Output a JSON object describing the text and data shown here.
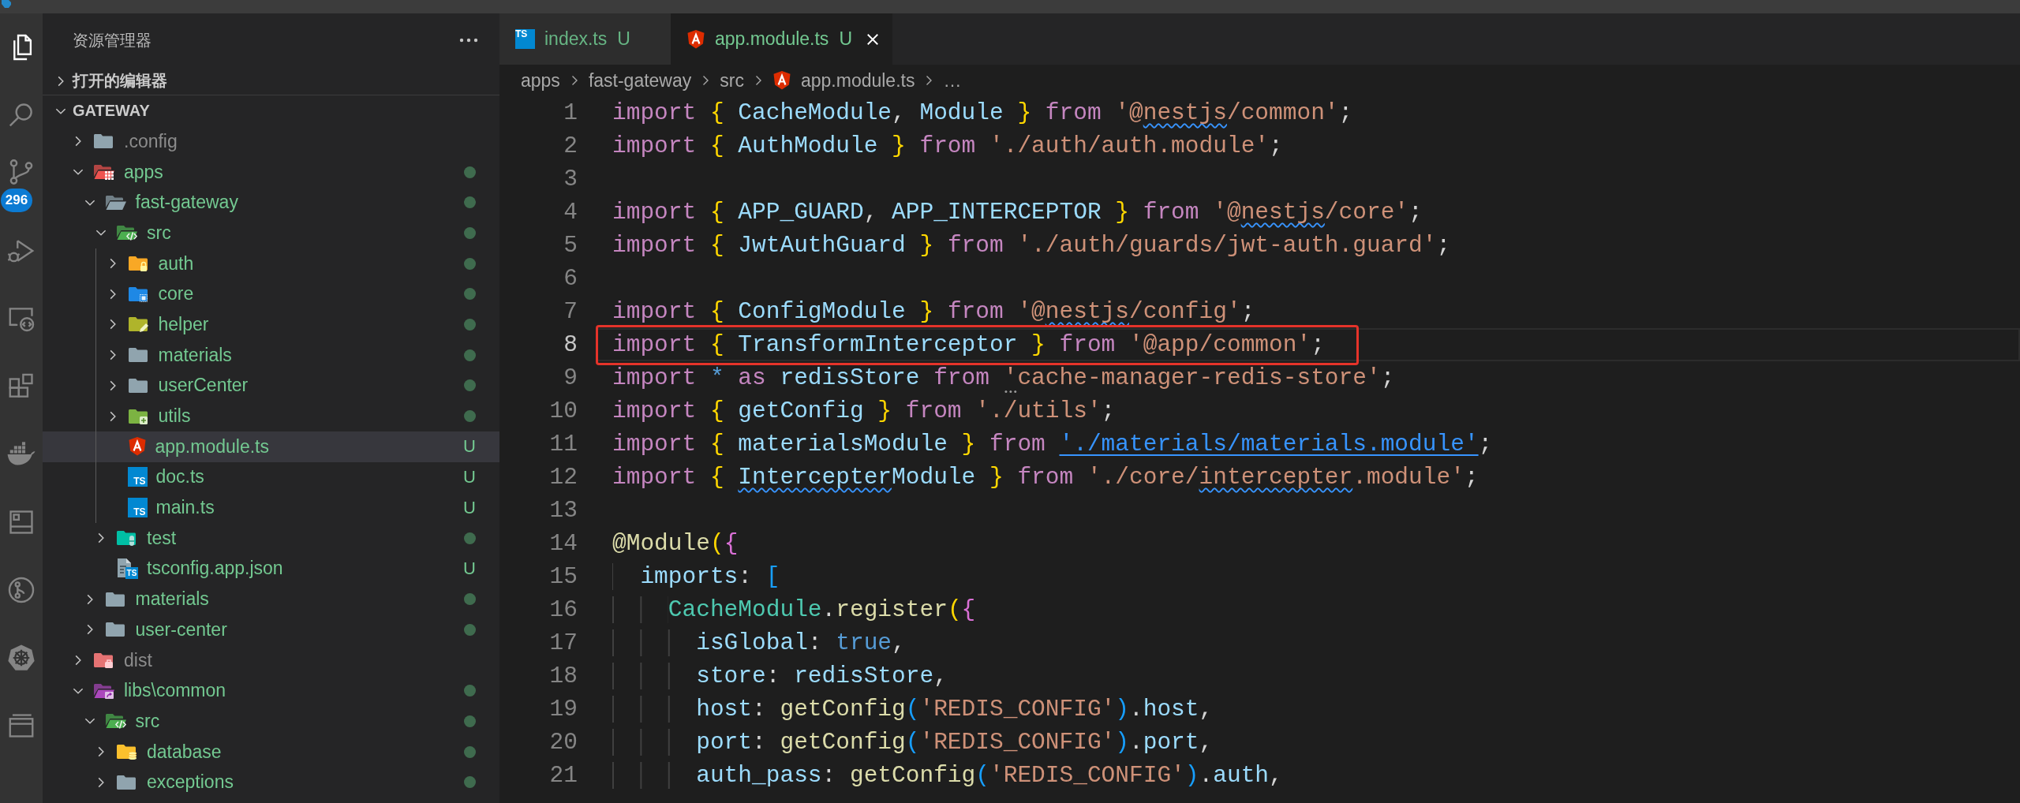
{
  "activity_bar": {
    "items": [
      {
        "kind": "explorer",
        "selected": true
      },
      {
        "kind": "search",
        "selected": false
      },
      {
        "kind": "scm",
        "selected": false,
        "badge": "296"
      },
      {
        "kind": "debug",
        "selected": false
      },
      {
        "kind": "remote",
        "selected": false
      },
      {
        "kind": "extensions",
        "selected": false
      },
      {
        "kind": "docker",
        "selected": false
      },
      {
        "kind": "panel",
        "selected": false
      },
      {
        "kind": "gitgraph",
        "selected": false
      },
      {
        "kind": "kubernetes",
        "selected": false
      },
      {
        "kind": "layers",
        "selected": false
      }
    ]
  },
  "explorer": {
    "title": "资源管理器",
    "sections": [
      {
        "title": "打开的编辑器",
        "expanded": false
      },
      {
        "title": "GATEWAY",
        "expanded": true,
        "tree": [
          {
            "label": ".config",
            "kind": "folder",
            "expanded": false,
            "selected": false,
            "ignored": true,
            "changed": false
          },
          {
            "label": "apps",
            "kind": "appsfolder",
            "expanded": true,
            "selected": false,
            "ignored": false,
            "changed": true,
            "children": [
              {
                "label": "fast-gateway",
                "kind": "folder",
                "expanded": true,
                "selected": false,
                "ignored": false,
                "changed": true,
                "children": [
                  {
                    "label": "src",
                    "kind": "srcfolder",
                    "expanded": true,
                    "selected": false,
                    "ignored": false,
                    "changed": true,
                    "children": [
                      {
                        "label": "auth",
                        "kind": "authfolder",
                        "expanded": false,
                        "selected": false,
                        "ignored": false,
                        "changed": true
                      },
                      {
                        "label": "core",
                        "kind": "corefolder",
                        "expanded": false,
                        "selected": false,
                        "ignored": false,
                        "changed": true
                      },
                      {
                        "label": "helper",
                        "kind": "helperfolder",
                        "expanded": false,
                        "selected": false,
                        "ignored": false,
                        "changed": true
                      },
                      {
                        "label": "materials",
                        "kind": "folder",
                        "expanded": false,
                        "selected": false,
                        "ignored": false,
                        "changed": true
                      },
                      {
                        "label": "userCenter",
                        "kind": "folder",
                        "expanded": false,
                        "selected": false,
                        "ignored": false,
                        "changed": true
                      },
                      {
                        "label": "utils",
                        "kind": "utilsfolder",
                        "expanded": false,
                        "selected": false,
                        "ignored": false,
                        "changed": true
                      },
                      {
                        "label": "app.module.ts",
                        "kind": "angular",
                        "selected": true,
                        "ignored": false,
                        "status": "U"
                      },
                      {
                        "label": "doc.ts",
                        "kind": "typescript",
                        "icon_text": "TS",
                        "selected": false,
                        "ignored": false,
                        "status": "U"
                      },
                      {
                        "label": "main.ts",
                        "kind": "typescript",
                        "icon_text": "TS",
                        "selected": false,
                        "ignored": false,
                        "status": "U"
                      }
                    ]
                  },
                  {
                    "label": "test",
                    "kind": "testfolder",
                    "expanded": false,
                    "selected": false,
                    "ignored": false,
                    "changed": true
                  },
                  {
                    "label": "tsconfig.app.json",
                    "kind": "tsconfig",
                    "icon_text": "TS",
                    "selected": false,
                    "ignored": false,
                    "status": "U"
                  }
                ]
              },
              {
                "label": "materials",
                "kind": "folder",
                "expanded": false,
                "selected": false,
                "ignored": false,
                "changed": true
              },
              {
                "label": "user-center",
                "kind": "folder",
                "expanded": false,
                "selected": false,
                "ignored": false,
                "changed": true
              }
            ]
          },
          {
            "label": "dist",
            "kind": "distfolder",
            "expanded": false,
            "selected": false,
            "ignored": true,
            "changed": false
          },
          {
            "label": "libs\\common",
            "kind": "libfolder",
            "expanded": true,
            "selected": false,
            "ignored": false,
            "changed": true,
            "children": [
              {
                "label": "src",
                "kind": "srcfolder",
                "expanded": true,
                "selected": false,
                "ignored": false,
                "changed": true,
                "children": [
                  {
                    "label": "database",
                    "kind": "databasefolder",
                    "expanded": false,
                    "selected": false,
                    "ignored": false,
                    "changed": true
                  },
                  {
                    "label": "exceptions",
                    "kind": "folder",
                    "expanded": false,
                    "selected": false,
                    "ignored": false,
                    "changed": true
                  }
                ]
              }
            ]
          }
        ]
      }
    ]
  },
  "editor": {
    "tabs": [
      {
        "label": "index.ts",
        "kind": "typescript",
        "icon_text": "TS",
        "status": "U",
        "selected": false
      },
      {
        "label": "app.module.ts",
        "kind": "angular",
        "status": "U",
        "selected": true
      }
    ],
    "breadcrumb": [
      {
        "label": "apps",
        "kind": "folder"
      },
      {
        "label": "fast-gateway",
        "kind": "folder"
      },
      {
        "label": "src",
        "kind": "folder"
      },
      {
        "label": "app.module.ts",
        "kind": "angular"
      },
      {
        "label": "…",
        "kind": "more"
      }
    ],
    "lines": [
      {
        "number": "1",
        "current": false,
        "annotated": false,
        "tokens": [
          {
            "text": "import ",
            "kind": "keyword"
          },
          {
            "text": "{ ",
            "kind": "bracket1"
          },
          {
            "text": "CacheModule",
            "kind": "variable"
          },
          {
            "text": ", ",
            "kind": "punctuation"
          },
          {
            "text": "Module ",
            "kind": "variable"
          },
          {
            "text": "} ",
            "kind": "bracket1"
          },
          {
            "text": "from ",
            "kind": "keyword"
          },
          {
            "text": "'@",
            "kind": "string"
          },
          {
            "text": "nestjs",
            "kind": "string",
            "squiggle": true
          },
          {
            "text": "/common'",
            "kind": "string"
          },
          {
            "text": ";",
            "kind": "punctuation"
          }
        ]
      },
      {
        "number": "2",
        "current": false,
        "annotated": false,
        "tokens": [
          {
            "text": "import ",
            "kind": "keyword"
          },
          {
            "text": "{ ",
            "kind": "bracket1"
          },
          {
            "text": "AuthModule ",
            "kind": "variable"
          },
          {
            "text": "} ",
            "kind": "bracket1"
          },
          {
            "text": "from ",
            "kind": "keyword"
          },
          {
            "text": "'./auth/auth.module'",
            "kind": "string"
          },
          {
            "text": ";",
            "kind": "punctuation"
          }
        ]
      },
      {
        "number": "3",
        "current": false,
        "annotated": false
      },
      {
        "number": "4",
        "current": false,
        "annotated": false,
        "tokens": [
          {
            "text": "import ",
            "kind": "keyword"
          },
          {
            "text": "{ ",
            "kind": "bracket1"
          },
          {
            "text": "APP_GUARD",
            "kind": "variable"
          },
          {
            "text": ", ",
            "kind": "punctuation"
          },
          {
            "text": "APP_INTERCEPTOR ",
            "kind": "variable"
          },
          {
            "text": "} ",
            "kind": "bracket1"
          },
          {
            "text": "from ",
            "kind": "keyword"
          },
          {
            "text": "'@",
            "kind": "string"
          },
          {
            "text": "nestjs",
            "kind": "string",
            "squiggle": true
          },
          {
            "text": "/core'",
            "kind": "string"
          },
          {
            "text": ";",
            "kind": "punctuation"
          }
        ]
      },
      {
        "number": "5",
        "current": false,
        "annotated": false,
        "tokens": [
          {
            "text": "import ",
            "kind": "keyword"
          },
          {
            "text": "{ ",
            "kind": "bracket1"
          },
          {
            "text": "JwtAuthGuard ",
            "kind": "variable"
          },
          {
            "text": "} ",
            "kind": "bracket1"
          },
          {
            "text": "from ",
            "kind": "keyword"
          },
          {
            "text": "'./auth/guards/jwt-auth.guard'",
            "kind": "string"
          },
          {
            "text": ";",
            "kind": "punctuation"
          }
        ]
      },
      {
        "number": "6",
        "current": false,
        "annotated": false
      },
      {
        "number": "7",
        "current": false,
        "annotated": false,
        "tokens": [
          {
            "text": "import ",
            "kind": "keyword"
          },
          {
            "text": "{ ",
            "kind": "bracket1"
          },
          {
            "text": "ConfigModule ",
            "kind": "variable"
          },
          {
            "text": "} ",
            "kind": "bracket1"
          },
          {
            "text": "from ",
            "kind": "keyword"
          },
          {
            "text": "'@",
            "kind": "string"
          },
          {
            "text": "nestjs",
            "kind": "string",
            "squiggle": true
          },
          {
            "text": "/config'",
            "kind": "string"
          },
          {
            "text": ";",
            "kind": "punctuation"
          }
        ]
      },
      {
        "number": "8",
        "current": true,
        "annotated": true,
        "tokens": [
          {
            "text": "import ",
            "kind": "keyword"
          },
          {
            "text": "{ ",
            "kind": "bracket1"
          },
          {
            "text": "TransformInterceptor ",
            "kind": "variable"
          },
          {
            "text": "} ",
            "kind": "bracket1"
          },
          {
            "text": "from ",
            "kind": "keyword"
          },
          {
            "text": "'@app/common'",
            "kind": "string"
          },
          {
            "text": ";",
            "kind": "punctuation"
          }
        ]
      },
      {
        "number": "9",
        "current": false,
        "annotated": false,
        "tokens": [
          {
            "text": "import ",
            "kind": "keyword"
          },
          {
            "text": "* ",
            "kind": "operator"
          },
          {
            "text": "as ",
            "kind": "keyword"
          },
          {
            "text": "redisStore ",
            "kind": "variable"
          },
          {
            "text": "from ",
            "kind": "keyword"
          },
          {
            "text": "'",
            "kind": "string",
            "hint": true
          },
          {
            "text": "cache-manager-redis-store'",
            "kind": "string"
          },
          {
            "text": ";",
            "kind": "punctuation"
          }
        ]
      },
      {
        "number": "10",
        "current": false,
        "annotated": false,
        "tokens": [
          {
            "text": "import ",
            "kind": "keyword"
          },
          {
            "text": "{ ",
            "kind": "bracket1"
          },
          {
            "text": "getConfig ",
            "kind": "variable"
          },
          {
            "text": "} ",
            "kind": "bracket1"
          },
          {
            "text": "from ",
            "kind": "keyword"
          },
          {
            "text": "'./utils'",
            "kind": "string"
          },
          {
            "text": ";",
            "kind": "punctuation"
          }
        ]
      },
      {
        "number": "11",
        "current": false,
        "annotated": false,
        "tokens": [
          {
            "text": "import ",
            "kind": "keyword"
          },
          {
            "text": "{ ",
            "kind": "bracket1"
          },
          {
            "text": "materialsModule ",
            "kind": "variable"
          },
          {
            "text": "} ",
            "kind": "bracket1"
          },
          {
            "text": "from ",
            "kind": "keyword"
          },
          {
            "text": "'./materials/materials.module'",
            "kind": "link"
          },
          {
            "text": ";",
            "kind": "punctuation"
          }
        ]
      },
      {
        "number": "12",
        "current": false,
        "annotated": false,
        "tokens": [
          {
            "text": "import ",
            "kind": "keyword"
          },
          {
            "text": "{ ",
            "kind": "bracket1"
          },
          {
            "text": "Intercepter",
            "kind": "variable",
            "squiggle": true
          },
          {
            "text": "Module ",
            "kind": "variable"
          },
          {
            "text": "} ",
            "kind": "bracket1"
          },
          {
            "text": "from ",
            "kind": "keyword"
          },
          {
            "text": "'./core/",
            "kind": "string"
          },
          {
            "text": "intercepter",
            "kind": "string",
            "squiggle": true
          },
          {
            "text": ".module'",
            "kind": "string"
          },
          {
            "text": ";",
            "kind": "punctuation"
          }
        ]
      },
      {
        "number": "13",
        "current": false,
        "annotated": false
      },
      {
        "number": "14",
        "current": false,
        "annotated": false,
        "tokens": [
          {
            "text": "@Module",
            "kind": "decorator"
          },
          {
            "text": "(",
            "kind": "bracket1"
          },
          {
            "text": "{",
            "kind": "bracket2"
          }
        ]
      },
      {
        "number": "15",
        "current": false,
        "annotated": false,
        "tokens": [
          {
            "text": "  imports",
            "kind": "variable"
          },
          {
            "text": ": ",
            "kind": "punctuation"
          },
          {
            "text": "[",
            "kind": "bracket3"
          }
        ]
      },
      {
        "number": "16",
        "current": false,
        "annotated": false,
        "tokens": [
          {
            "text": "    CacheModule",
            "kind": "class"
          },
          {
            "text": ".",
            "kind": "punctuation"
          },
          {
            "text": "register",
            "kind": "function"
          },
          {
            "text": "(",
            "kind": "bracket1"
          },
          {
            "text": "{",
            "kind": "bracket2"
          }
        ]
      },
      {
        "number": "17",
        "current": false,
        "annotated": false,
        "tokens": [
          {
            "text": "      isGlobal",
            "kind": "variable"
          },
          {
            "text": ": ",
            "kind": "punctuation"
          },
          {
            "text": "true",
            "kind": "boolean"
          },
          {
            "text": ",",
            "kind": "punctuation"
          }
        ]
      },
      {
        "number": "18",
        "current": false,
        "annotated": false,
        "tokens": [
          {
            "text": "      store",
            "kind": "variable"
          },
          {
            "text": ": ",
            "kind": "punctuation"
          },
          {
            "text": "redisStore",
            "kind": "variable"
          },
          {
            "text": ",",
            "kind": "punctuation"
          }
        ]
      },
      {
        "number": "19",
        "current": false,
        "annotated": false,
        "tokens": [
          {
            "text": "      host",
            "kind": "variable"
          },
          {
            "text": ": ",
            "kind": "punctuation"
          },
          {
            "text": "getConfig",
            "kind": "function"
          },
          {
            "text": "(",
            "kind": "bracket3"
          },
          {
            "text": "'REDIS_CONFIG'",
            "kind": "string"
          },
          {
            "text": ")",
            "kind": "bracket3"
          },
          {
            "text": ".",
            "kind": "punctuation"
          },
          {
            "text": "host",
            "kind": "variable"
          },
          {
            "text": ",",
            "kind": "punctuation"
          }
        ]
      },
      {
        "number": "20",
        "current": false,
        "annotated": false,
        "tokens": [
          {
            "text": "      port",
            "kind": "variable"
          },
          {
            "text": ": ",
            "kind": "punctuation"
          },
          {
            "text": "getConfig",
            "kind": "function"
          },
          {
            "text": "(",
            "kind": "bracket3"
          },
          {
            "text": "'REDIS_CONFIG'",
            "kind": "string"
          },
          {
            "text": ")",
            "kind": "bracket3"
          },
          {
            "text": ".",
            "kind": "punctuation"
          },
          {
            "text": "port",
            "kind": "variable"
          },
          {
            "text": ",",
            "kind": "punctuation"
          }
        ]
      },
      {
        "number": "21",
        "current": false,
        "annotated": false,
        "tokens": [
          {
            "text": "      auth_pass",
            "kind": "variable"
          },
          {
            "text": ": ",
            "kind": "punctuation"
          },
          {
            "text": "getConfig",
            "kind": "function"
          },
          {
            "text": "(",
            "kind": "bracket3"
          },
          {
            "text": "'REDIS_CONFIG'",
            "kind": "string"
          },
          {
            "text": ")",
            "kind": "bracket3"
          },
          {
            "text": ".",
            "kind": "punctuation"
          },
          {
            "text": "auth",
            "kind": "variable"
          },
          {
            "text": ",",
            "kind": "punctuation"
          }
        ]
      }
    ]
  }
}
